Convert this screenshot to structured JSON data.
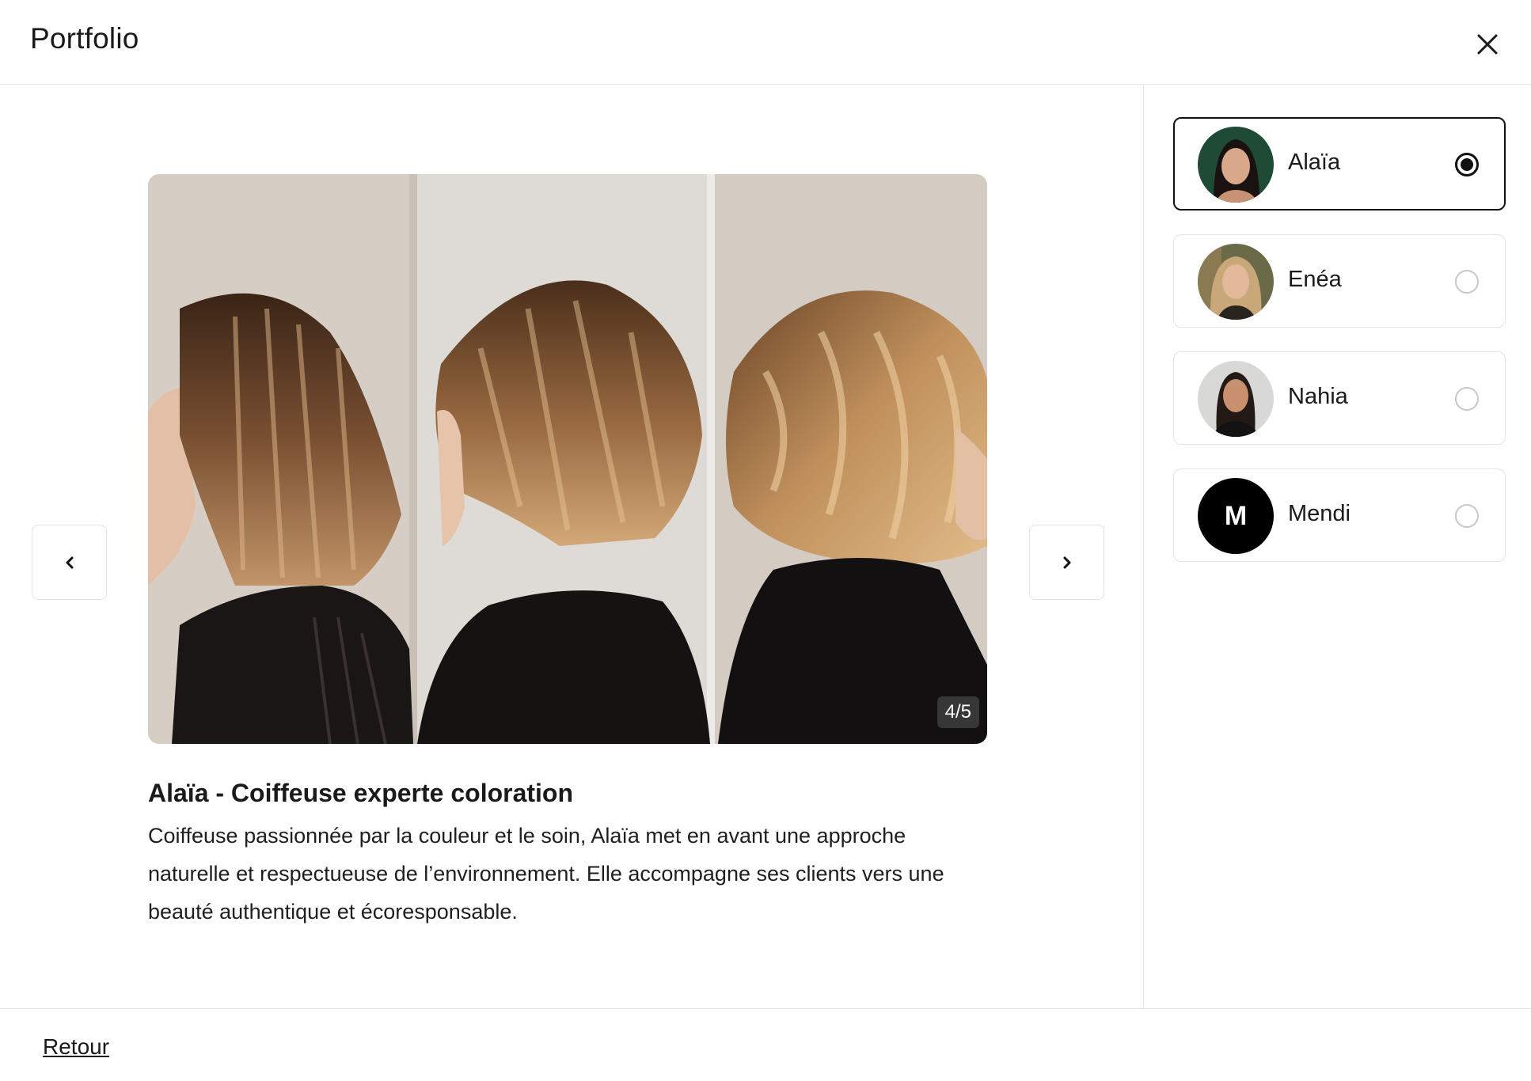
{
  "header": {
    "title": "Portfolio"
  },
  "gallery": {
    "counter": "4/5",
    "current_index": 4,
    "total": 5
  },
  "stylist": {
    "heading": "Alaïa - Coiffeuse experte coloration",
    "description": "Coiffeuse passionnée par la couleur et le soin, Alaïa met en avant une approche naturelle et respectueuse de l’environnement. Elle accompagne ses clients vers une beauté authentique et écoresponsable."
  },
  "stylists": [
    {
      "name": "Alaïa",
      "selected": true
    },
    {
      "name": "Enéa",
      "selected": false
    },
    {
      "name": "Nahia",
      "selected": false
    },
    {
      "name": "Mendi",
      "selected": false,
      "initial": "M"
    }
  ],
  "footer": {
    "back_label": "Retour"
  },
  "colors": {
    "border": "#e6e6e6",
    "selected_border": "#111111",
    "text": "#1a1a1a",
    "counter_bg": "#464646"
  }
}
